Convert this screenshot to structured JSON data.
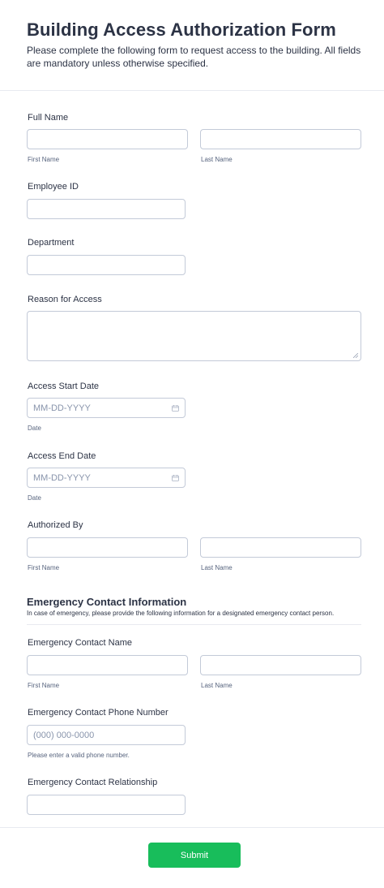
{
  "header": {
    "title": "Building Access Authorization Form",
    "subtitle": "Please complete the following form to request access to the building. All fields are mandatory unless otherwise specified."
  },
  "fields": {
    "full_name": {
      "label": "Full Name",
      "first_sub": "First Name",
      "last_sub": "Last Name"
    },
    "employee_id": {
      "label": "Employee ID"
    },
    "department": {
      "label": "Department"
    },
    "reason": {
      "label": "Reason for Access"
    },
    "start_date": {
      "label": "Access Start Date",
      "placeholder": "MM-DD-YYYY",
      "sub": "Date"
    },
    "end_date": {
      "label": "Access End Date",
      "placeholder": "MM-DD-YYYY",
      "sub": "Date"
    },
    "authorized_by": {
      "label": "Authorized By",
      "first_sub": "First Name",
      "last_sub": "Last Name"
    }
  },
  "emergency": {
    "title": "Emergency Contact Information",
    "description": "In case of emergency, please provide the following information for a designated emergency contact person.",
    "name": {
      "label": "Emergency Contact Name",
      "first_sub": "First Name",
      "last_sub": "Last Name"
    },
    "phone": {
      "label": "Emergency Contact Phone Number",
      "placeholder": "(000) 000-0000",
      "sub": "Please enter a valid phone number."
    },
    "relationship": {
      "label": "Emergency Contact Relationship"
    }
  },
  "submit_label": "Submit",
  "colors": {
    "accent": "#18bd5b",
    "text": "#2c3345",
    "border": "#c3cad8",
    "placeholder": "#8894ab"
  },
  "icons": {
    "date": "calendar-icon",
    "textarea": "resize-handle-icon"
  }
}
